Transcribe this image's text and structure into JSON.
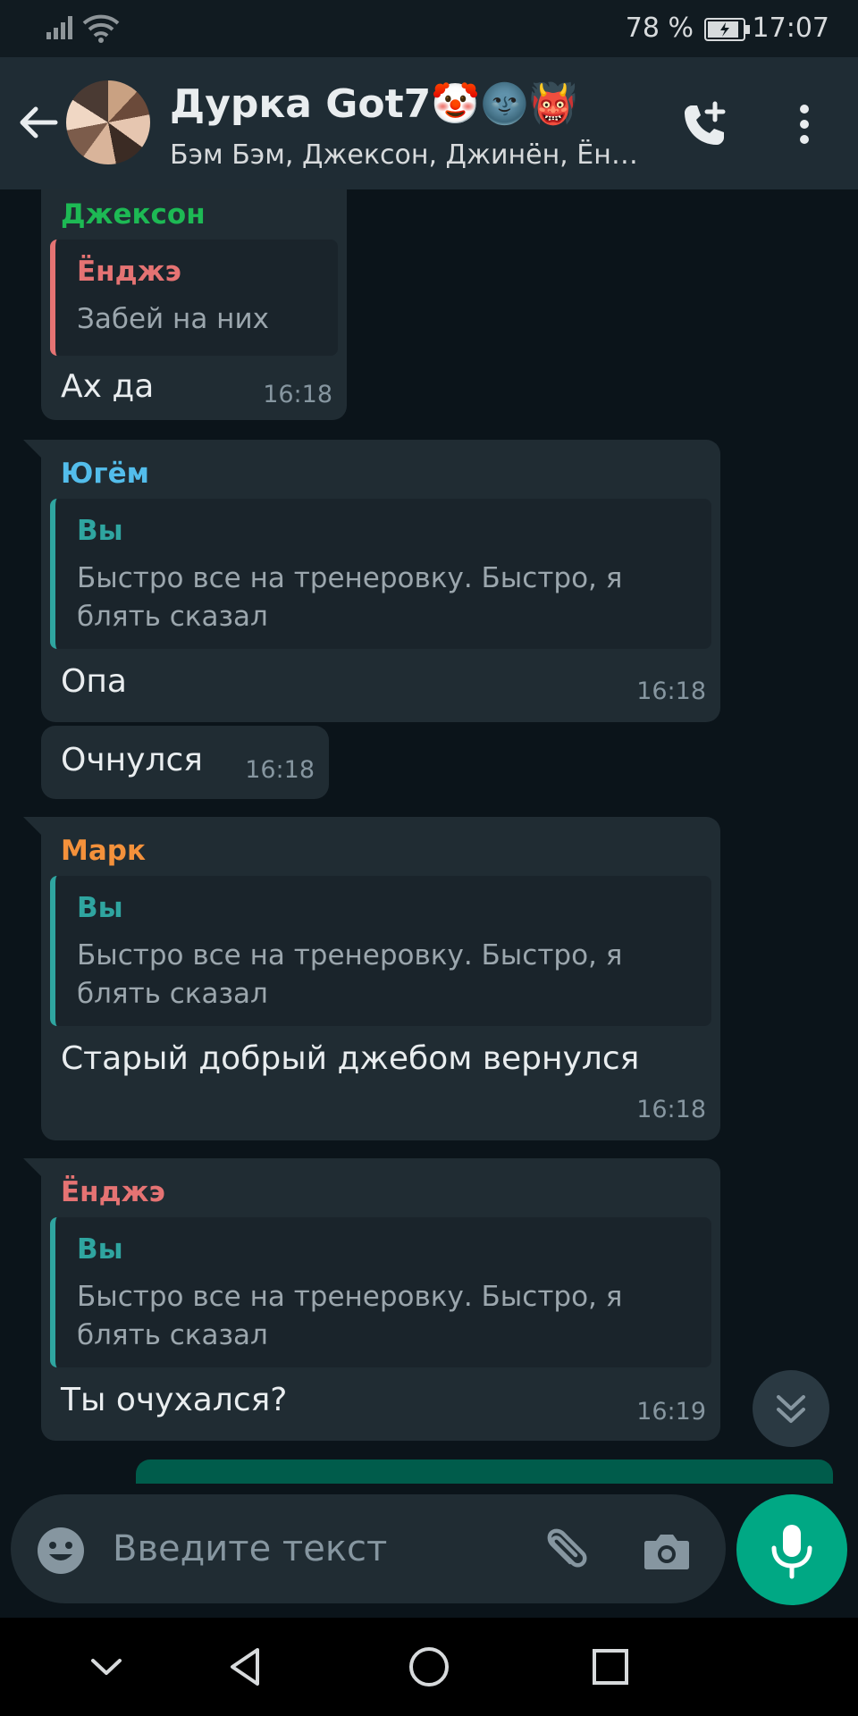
{
  "status_bar": {
    "battery_percent": "78 %",
    "time": "17:07"
  },
  "header": {
    "title": "Дурка Got7🤡🌚👹",
    "subtitle": "Бэм Бэм, Джексон, Джинён, Ён…"
  },
  "colors": {
    "header_bg": "#1f2c34",
    "chat_bg": "#0b141a",
    "bubble_in": "#202c33",
    "bubble_out": "#005c4b",
    "accent": "#00a884",
    "sender_jackson": "#1db954",
    "sender_youngjae": "#e57373",
    "sender_yugyeom": "#53bdeb",
    "sender_mark": "#f4913b",
    "quote_you": "#2fa5a0"
  },
  "messages": [
    {
      "sender": "Джексон",
      "quote_name": "Ёнджэ",
      "quote_text": "Забей на них",
      "text": "Ах да",
      "time": "16:18"
    },
    {
      "sender": "Югём",
      "quote_name": "Вы",
      "quote_text": "Быстро все на тренеровку. Быстро, я блять сказал",
      "text": "Опа",
      "time": "16:18"
    },
    {
      "text": "Очнулся",
      "time": "16:18"
    },
    {
      "sender": "Марк",
      "quote_name": "Вы",
      "quote_text": "Быстро все на тренеровку. Быстро, я блять сказал",
      "text": "Старый добрый джебом вернулся",
      "time": "16:18"
    },
    {
      "sender": "Ёнджэ",
      "quote_name": "Вы",
      "quote_text": "Быстро все на тренеровку. Быстро, я блять сказал",
      "text": "Ты очухался?",
      "time": "16:19"
    }
  ],
  "input": {
    "placeholder": "Введите текст"
  },
  "icons": {
    "back": "arrow-back-icon",
    "call": "add-call-icon",
    "menu": "more-vert-icon",
    "emoji": "emoji-icon",
    "attach": "paperclip-icon",
    "camera": "camera-icon",
    "mic": "mic-icon",
    "scroll": "double-chevron-down-icon"
  }
}
